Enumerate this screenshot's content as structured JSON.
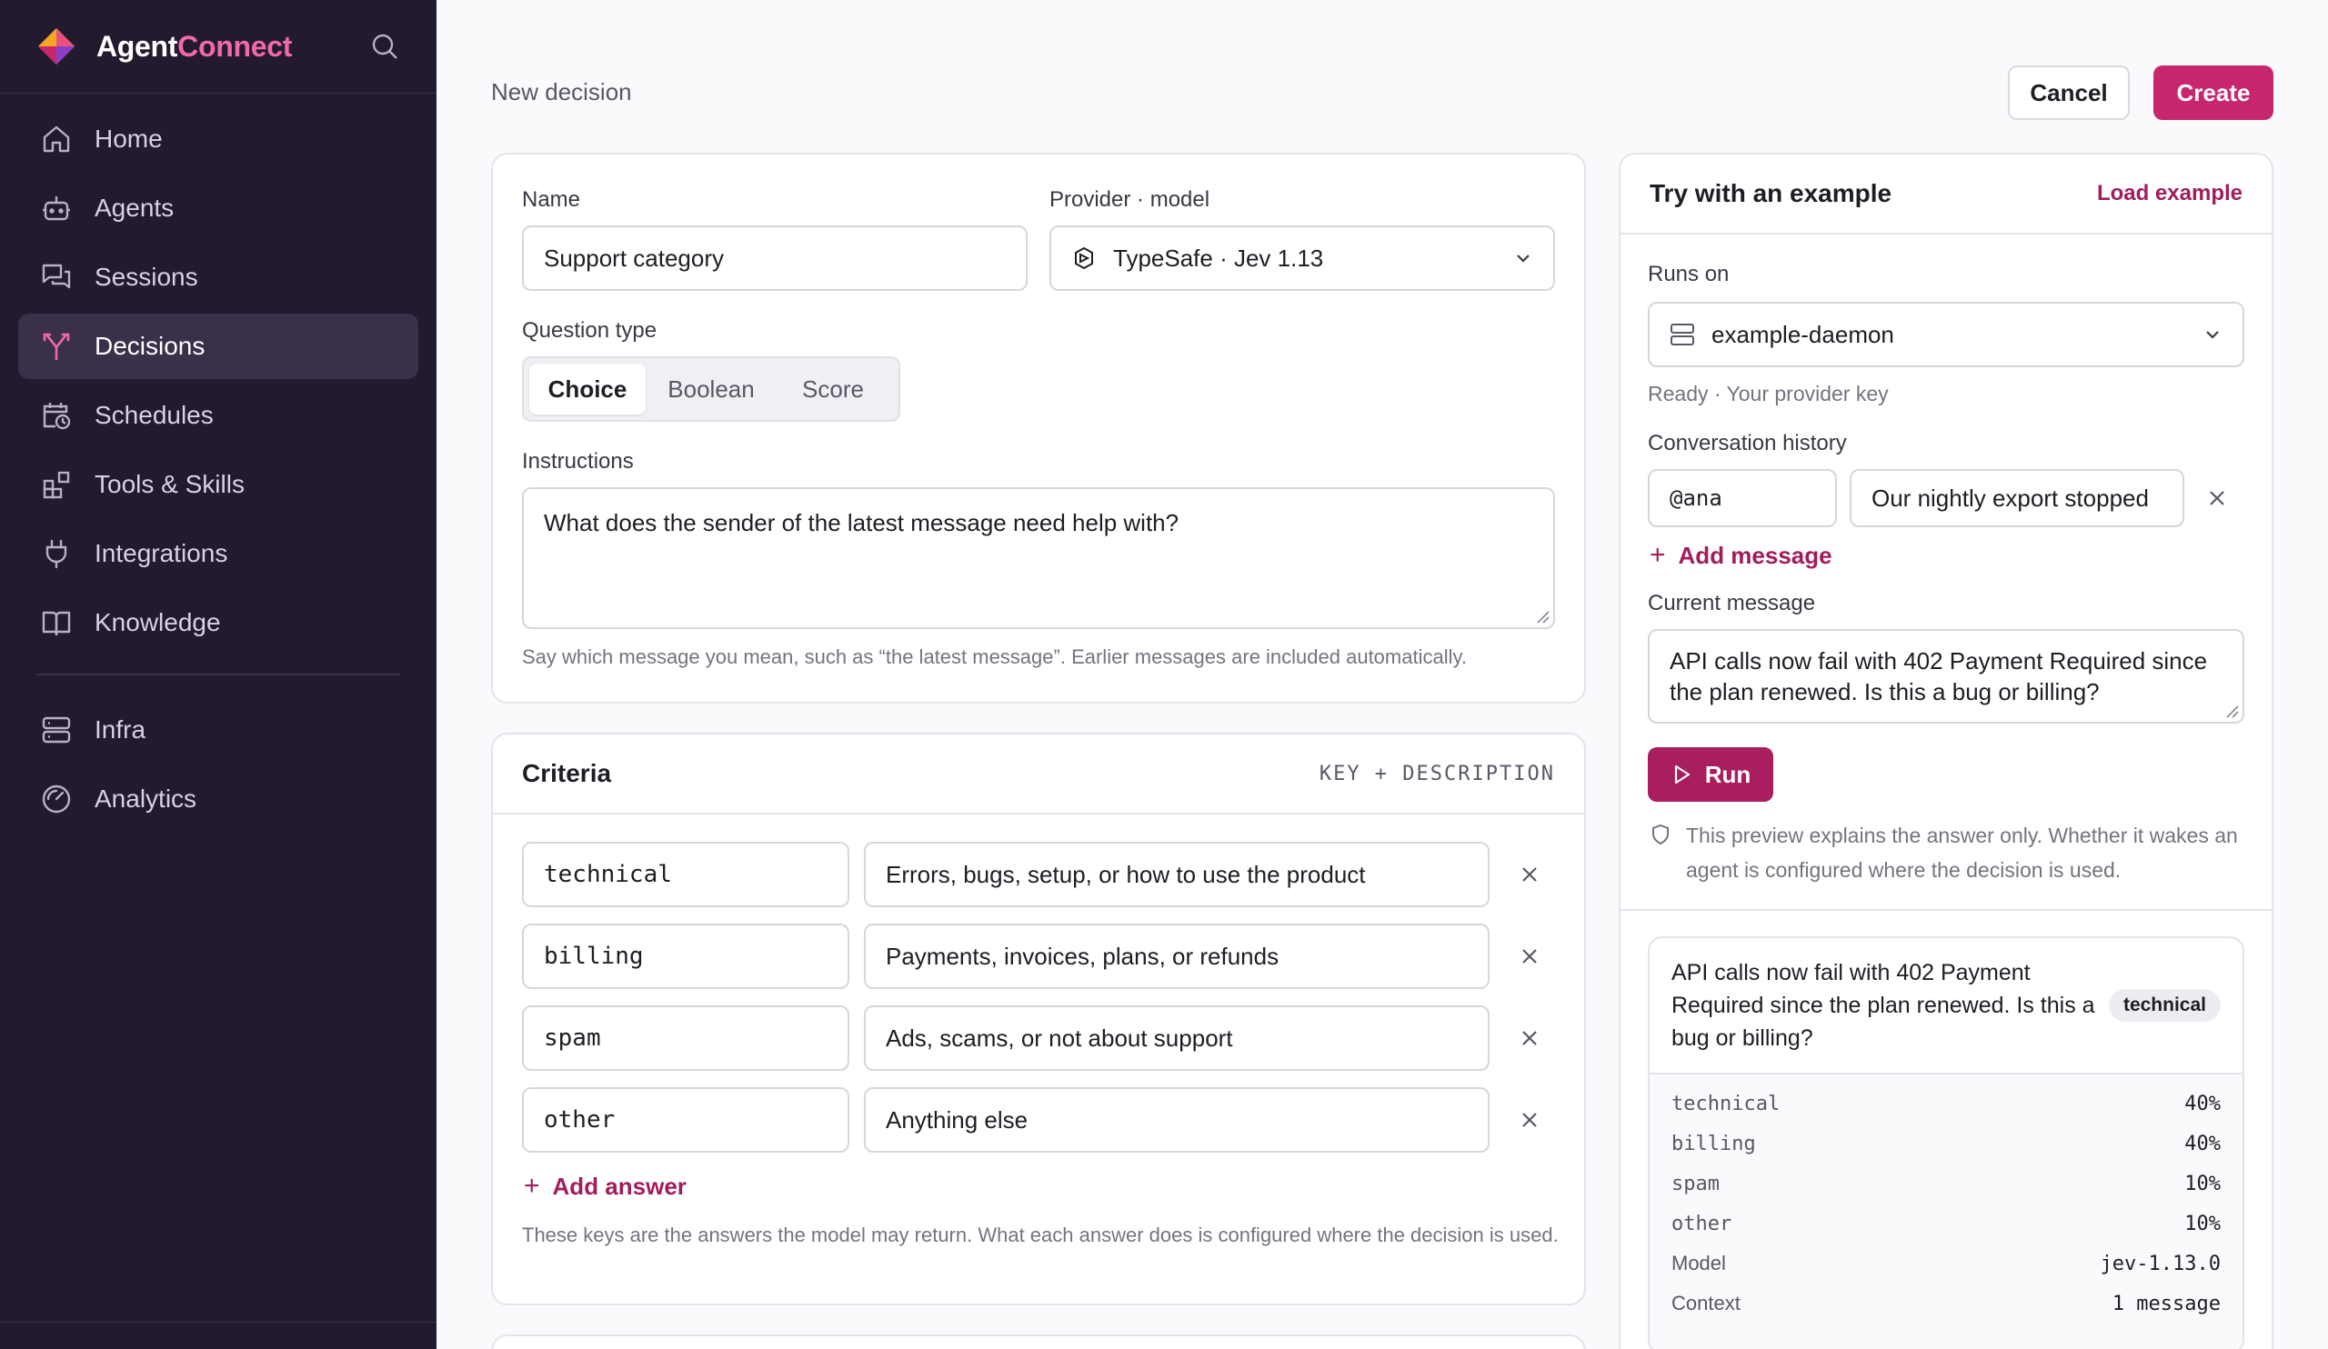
{
  "brand": {
    "name_part1": "Agent",
    "name_part2": "Connect"
  },
  "sidebar": {
    "items": [
      {
        "label": "Home"
      },
      {
        "label": "Agents"
      },
      {
        "label": "Sessions"
      },
      {
        "label": "Decisions"
      },
      {
        "label": "Schedules"
      },
      {
        "label": "Tools & Skills"
      },
      {
        "label": "Integrations"
      },
      {
        "label": "Knowledge"
      },
      {
        "label": "Infra"
      },
      {
        "label": "Analytics"
      }
    ]
  },
  "header": {
    "title": "New decision",
    "cancel_label": "Cancel",
    "create_label": "Create"
  },
  "form": {
    "name_label": "Name",
    "name_value": "Support category",
    "provider_label": "Provider · model",
    "provider_value": "TypeSafe · Jev 1.13",
    "question_type_label": "Question type",
    "question_types": [
      "Choice",
      "Boolean",
      "Score"
    ],
    "selected_question_type": "Choice",
    "instructions_label": "Instructions",
    "instructions_value": "What does the sender of the latest message need help with?",
    "instructions_hint": "Say which message you mean, such as “the latest message”. Earlier messages are included automatically."
  },
  "criteria": {
    "title": "Criteria",
    "header_right": "KEY + DESCRIPTION",
    "rows": [
      {
        "key": "technical",
        "description": "Errors, bugs, setup, or how to use the product"
      },
      {
        "key": "billing",
        "description": "Payments, invoices, plans, or refunds"
      },
      {
        "key": "spam",
        "description": "Ads, scams, or not about support"
      },
      {
        "key": "other",
        "description": "Anything else"
      }
    ],
    "add_label": "Add answer",
    "hint": "These keys are the answers the model may return. What each answer does is configured where the decision is used."
  },
  "example": {
    "title": "Try with an example",
    "load_label": "Load example",
    "runs_on_label": "Runs on",
    "runs_on_value": "example-daemon",
    "status_text": "Ready · Your provider key",
    "history_label": "Conversation history",
    "history_user": "@ana",
    "history_message": "Our nightly export stopped",
    "add_message_label": "Add message",
    "current_label": "Current message",
    "current_value": "API calls now fail with 402 Payment Required since the plan renewed. Is this a bug or billing?",
    "run_label": "Run",
    "note": "This preview explains the answer only. Whether it wakes an agent is configured where the decision is used."
  },
  "result": {
    "message": "API calls now fail with 402 Payment Required since the plan renewed. Is this a bug or billing?",
    "tag": "technical",
    "scores": [
      {
        "key": "technical",
        "value": "40%"
      },
      {
        "key": "billing",
        "value": "40%"
      },
      {
        "key": "spam",
        "value": "10%"
      },
      {
        "key": "other",
        "value": "10%"
      }
    ],
    "model_label": "Model",
    "model_value": "jev-1.13.0",
    "context_label": "Context",
    "context_value": "1 message"
  },
  "colors": {
    "accent": "#c8266f",
    "sidebar_bg": "#231a30",
    "link": "#a01d5c"
  }
}
